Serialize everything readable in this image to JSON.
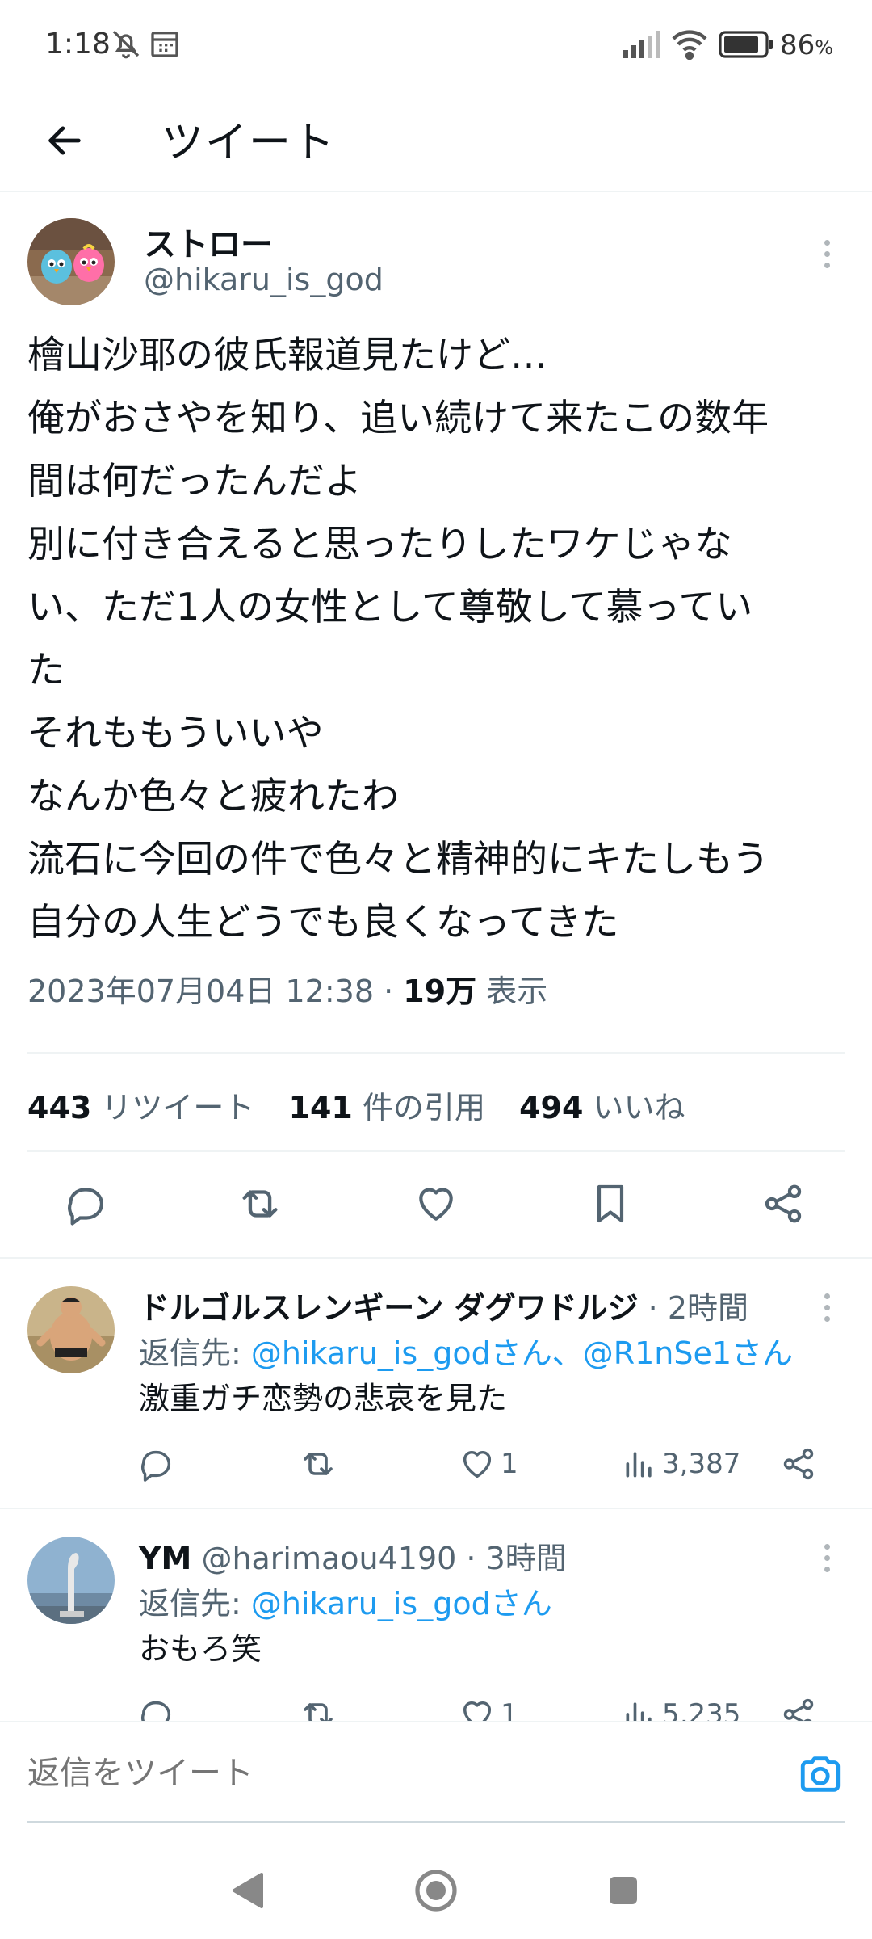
{
  "status_bar": {
    "time": "1:18",
    "battery": "86",
    "battery_unit": "%"
  },
  "header": {
    "title": "ツイート"
  },
  "tweet": {
    "author_name": "ストロー",
    "author_handle": "@hikaru_is_god",
    "body_lines": [
      "檜山沙耶の彼氏報道見たけど…",
      "俺がおさやを知り、追い続けて来たこの数年",
      "間は何だったんだよ",
      "別に付き合えると思ったりしたワケじゃな",
      "い、ただ1人の女性として尊敬して慕ってい",
      "た",
      "それももういいや",
      "なんか色々と疲れたわ",
      "流石に今回の件で色々と精神的にキたしもう",
      "自分の人生どうでも良くなってきた"
    ],
    "timestamp": "2023年07月04日 12:38",
    "views_count": "19万",
    "views_label": "表示",
    "retweets_count": "443",
    "retweets_label": "リツイート",
    "quotes_count": "141",
    "quotes_label": "件の引用",
    "likes_count": "494",
    "likes_label": "いいね"
  },
  "replies": [
    {
      "name": "ドルゴルスレンギーン ダグワドルジ",
      "handle": "",
      "time": "2時間",
      "reply_to_prefix": "返信先: ",
      "reply_to_links": "@hikaru_is_godさん、@R1nSe1さん",
      "text": "激重ガチ恋勢の悲哀を見た",
      "likes": "1",
      "views": "3,387"
    },
    {
      "name": "YM",
      "handle": "@harimaou4190",
      "time": "3時間",
      "reply_to_prefix": "返信先: ",
      "reply_to_links": "@hikaru_is_godさん",
      "text": "おもろ笑",
      "likes": "1",
      "views": "5,235"
    }
  ],
  "compose": {
    "placeholder": "返信をツイート"
  },
  "icons": {
    "back": "arrow-left-icon",
    "reply": "comment-icon",
    "retweet": "retweet-icon",
    "like": "heart-icon",
    "bookmark": "bookmark-icon",
    "share": "share-icon",
    "camera": "camera-icon"
  },
  "colors": {
    "accent": "#1d9bf0",
    "muted": "#536471",
    "text": "#0f1419"
  }
}
